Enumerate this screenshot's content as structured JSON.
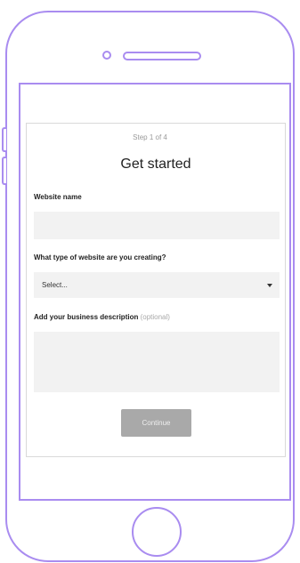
{
  "colors": {
    "frame": "#a98cf0",
    "field_bg": "#f2f2f2",
    "button_bg": "#a9a9a9"
  },
  "form": {
    "step": "Step 1 of 4",
    "title": "Get started",
    "website_name_label": "Website name",
    "website_name_value": "",
    "type_label": "What type of website are you creating?",
    "type_selected": "Select...",
    "description_label": "Add your business description",
    "description_optional": "(optional)",
    "description_value": "",
    "continue_label": "Continue"
  },
  "icons": {
    "select_caret": "chevron-down-icon"
  }
}
